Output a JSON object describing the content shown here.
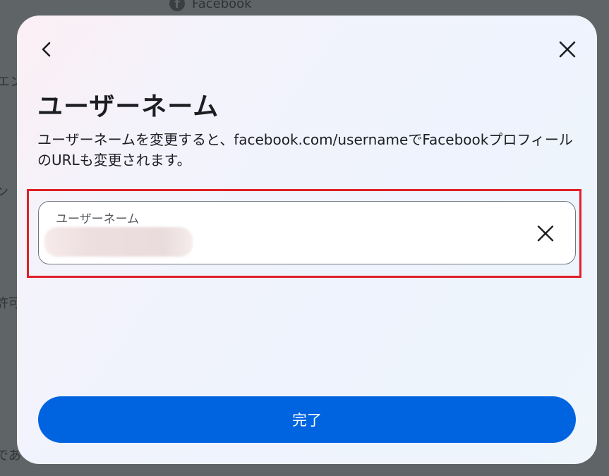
{
  "background": {
    "top_label": "Facebook",
    "side_fragments": [
      "エン",
      "ン",
      "許可",
      "であ"
    ]
  },
  "dialog": {
    "title": "ユーザーネーム",
    "description": "ユーザーネームを変更すると、facebook.com/usernameでFacebookプロフィールのURLも変更されます。",
    "field": {
      "label": "ユーザーネーム",
      "value_redacted": true
    },
    "done_button_label": "完了"
  },
  "icons": {
    "back": "chevron-left-icon",
    "close": "close-icon",
    "clear": "clear-icon",
    "facebook": "facebook-icon"
  },
  "colors": {
    "primary": "#0064e0",
    "highlight": "#e0202a",
    "overlay": "#5f6566"
  }
}
